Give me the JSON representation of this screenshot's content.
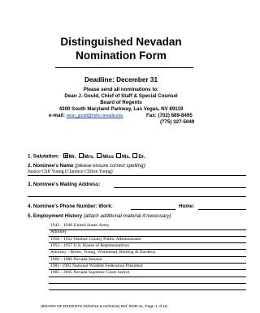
{
  "header": {
    "title_line1": "Distinguished Nevadan",
    "title_line2": "Nomination Form"
  },
  "deadline": {
    "label": "Deadline: December 31",
    "send_to": "Please send all nominations to:",
    "recipient": "Dean J. Gould, Chief of Staff & Special Counsel",
    "org": "Board of Regents",
    "address": "4300 South Maryland Parkway, Las Vegas, NV  89119",
    "email_label": "e-mail:",
    "email": "dean_gould@nshe.nevada.edu",
    "fax_label": "Fax: (702) 889-8495",
    "phone": "(775) 327-5049"
  },
  "form": {
    "salutation": {
      "label": "1.   Salutation:",
      "options": [
        {
          "label": "Mr.",
          "checked": true
        },
        {
          "label": "Mrs.",
          "checked": false
        },
        {
          "label": "Miss",
          "checked": false
        },
        {
          "label": "Ms.",
          "checked": false
        },
        {
          "label": "Dr.",
          "checked": false
        }
      ]
    },
    "nominee_name": {
      "label": "2.   Nominee's Name",
      "hint": "(please ensure correct spelling):",
      "value": "Justice Cliff Young   (Clarence Clifton Young)"
    },
    "mailing_address": {
      "label": "3.   Nominee's Mailing Address:"
    },
    "phone": {
      "label": "4.   Nominee's Phone Number:  Work:",
      "home_label": "Home:"
    },
    "employment": {
      "label": "5.   Employment History",
      "hint": "(attach additional material if necessary)",
      "entries": [
        "1943 - 1948 United States Army",
        "Attorney",
        "1950 - 1952 Washoe County Public Administrator",
        "1953 - 1957 U.S. House of Representatives",
        "Attorney - Breen, Young, Whitehead, Belding & Hardesty",
        "1966 - 1980 Nevada Senator",
        "1981- 1983 National Wildlife Federation President",
        "1985 - 2005 Nevada Supreme Court Justice",
        "",
        ""
      ]
    }
  },
  "footer": {
    "text": "(BOARD OF REGENTS  02/03/16 & 02/04/16)  Ref. BOR-11, Page 1 of 16"
  }
}
